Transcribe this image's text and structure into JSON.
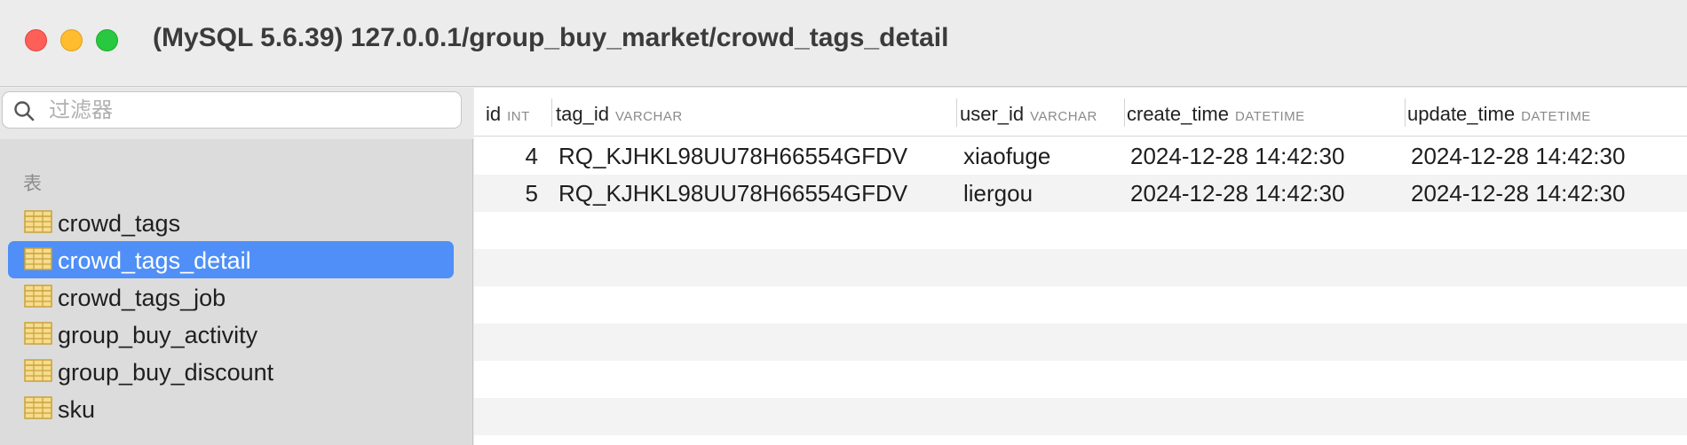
{
  "window": {
    "title": "(MySQL 5.6.39) 127.0.0.1/group_buy_market/crowd_tags_detail"
  },
  "sidebar": {
    "search": {
      "placeholder": "过滤器",
      "value": ""
    },
    "section_label": "表",
    "tables": [
      {
        "label": "crowd_tags",
        "selected": false
      },
      {
        "label": "crowd_tags_detail",
        "selected": true
      },
      {
        "label": "crowd_tags_job",
        "selected": false
      },
      {
        "label": "group_buy_activity",
        "selected": false
      },
      {
        "label": "group_buy_discount",
        "selected": false
      },
      {
        "label": "sku",
        "selected": false
      }
    ]
  },
  "grid": {
    "columns": [
      {
        "name": "id",
        "type": "INT"
      },
      {
        "name": "tag_id",
        "type": "VARCHAR"
      },
      {
        "name": "user_id",
        "type": "VARCHAR"
      },
      {
        "name": "create_time",
        "type": "DATETIME"
      },
      {
        "name": "update_time",
        "type": "DATETIME"
      }
    ],
    "rows": [
      {
        "id": "4",
        "tag_id": "RQ_KJHKL98UU78H66554GFDV",
        "user_id": "xiaofuge",
        "create_time": "2024-12-28 14:42:30",
        "update_time": "2024-12-28 14:42:30"
      },
      {
        "id": "5",
        "tag_id": "RQ_KJHKL98UU78H66554GFDV",
        "user_id": "liergou",
        "create_time": "2024-12-28 14:42:30",
        "update_time": "2024-12-28 14:42:30"
      }
    ]
  },
  "colors": {
    "selection": "#4f8ff7",
    "close": "#fe5f57",
    "minimize": "#febc2e",
    "maximize": "#28c840"
  },
  "icons": {
    "search": "search-icon",
    "table": "table-icon"
  }
}
